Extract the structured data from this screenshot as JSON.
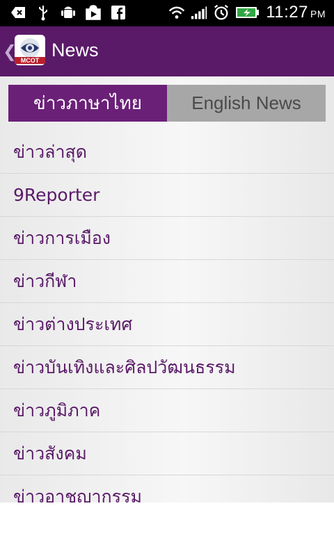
{
  "status_bar": {
    "time": "11:27",
    "ampm": "PM",
    "icons": [
      "back-arrow-icon",
      "usb-icon",
      "android-debug-icon",
      "play-store-icon",
      "facebook-icon",
      "wifi-icon",
      "signal-icon",
      "alarm-icon",
      "battery-charging-icon"
    ]
  },
  "app_bar": {
    "title": "News",
    "logo_text": "MCOT"
  },
  "tabs": [
    {
      "label": "ข่าวภาษาไทย",
      "active": true
    },
    {
      "label": "English News",
      "active": false
    }
  ],
  "list_items": [
    "ข่าวล่าสุด",
    "9Reporter",
    "ข่าวการเมือง",
    "ข่าวกีฬา",
    "ข่าวต่างประเทศ",
    "ข่าวบันเทิงและศิลปวัฒนธรรม",
    "ข่าวภูมิภาค",
    "ข่าวสังคม",
    "ข่าวอาชญากรรม"
  ],
  "colors": {
    "brand_purple": "#5a1a68",
    "tab_active": "#6b2078",
    "tab_inactive": "#a7a7a7"
  }
}
